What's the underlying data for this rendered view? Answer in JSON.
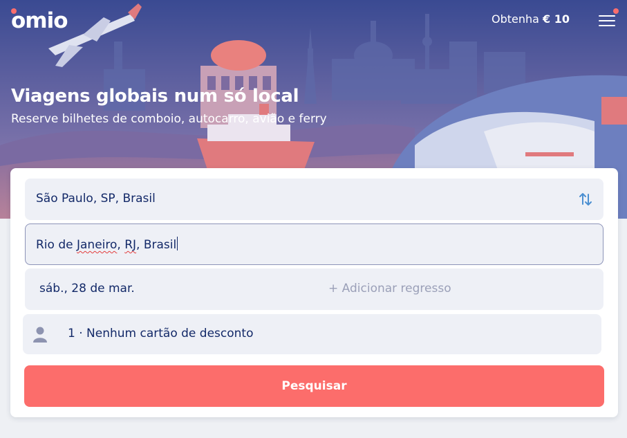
{
  "header": {
    "logo_text": "omio",
    "promo_prefix": "Obtenha ",
    "promo_amount": "€ 10",
    "menu_icon": "hamburger-menu-icon"
  },
  "hero": {
    "title": "Viagens globais num só local",
    "subtitle": "Reserve bilhetes de comboio, autocarro, avião e ferry"
  },
  "search": {
    "from_value": "São Paulo, SP, Brasil",
    "to_value_parts": [
      "Rio de ",
      "Janeiro",
      ", ",
      "RJ",
      ", Brasil"
    ],
    "departure_date": "sáb., 28 de mar.",
    "return_placeholder": "+ Adicionar regresso",
    "passengers": "1 · Nenhum cartão de desconto",
    "search_button": "Pesquisar",
    "swap_icon": "swap-vertical-icon",
    "passenger_icon": "person-icon"
  },
  "colors": {
    "accent": "#fc6d6b",
    "text": "#132968",
    "field_bg": "#eef0f6",
    "placeholder": "#9ba0b8",
    "swap_icon": "#4b8fd1"
  }
}
